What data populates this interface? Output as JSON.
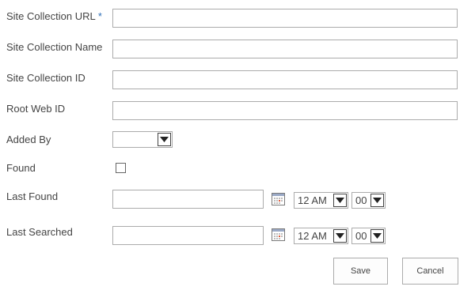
{
  "form": {
    "site_collection_url": {
      "label": "Site Collection URL",
      "required_marker": "*",
      "value": ""
    },
    "site_collection_name": {
      "label": "Site Collection Name",
      "value": ""
    },
    "site_collection_id": {
      "label": "Site Collection ID",
      "value": ""
    },
    "root_web_id": {
      "label": "Root Web ID",
      "value": ""
    },
    "added_by": {
      "label": "Added By",
      "selected": ""
    },
    "found": {
      "label": "Found",
      "checked": false
    },
    "last_found": {
      "label": "Last Found",
      "date": "",
      "hour": "12 AM",
      "minute": "00",
      "calendar_icon": "calendar-icon"
    },
    "last_searched": {
      "label": "Last Searched",
      "date": "",
      "hour": "12 AM",
      "minute": "00",
      "calendar_icon": "calendar-icon"
    }
  },
  "actions": {
    "save_label": "Save",
    "cancel_label": "Cancel"
  },
  "colors": {
    "required_marker": "#2e6fb7",
    "border": "#ababab",
    "text": "#444444"
  }
}
